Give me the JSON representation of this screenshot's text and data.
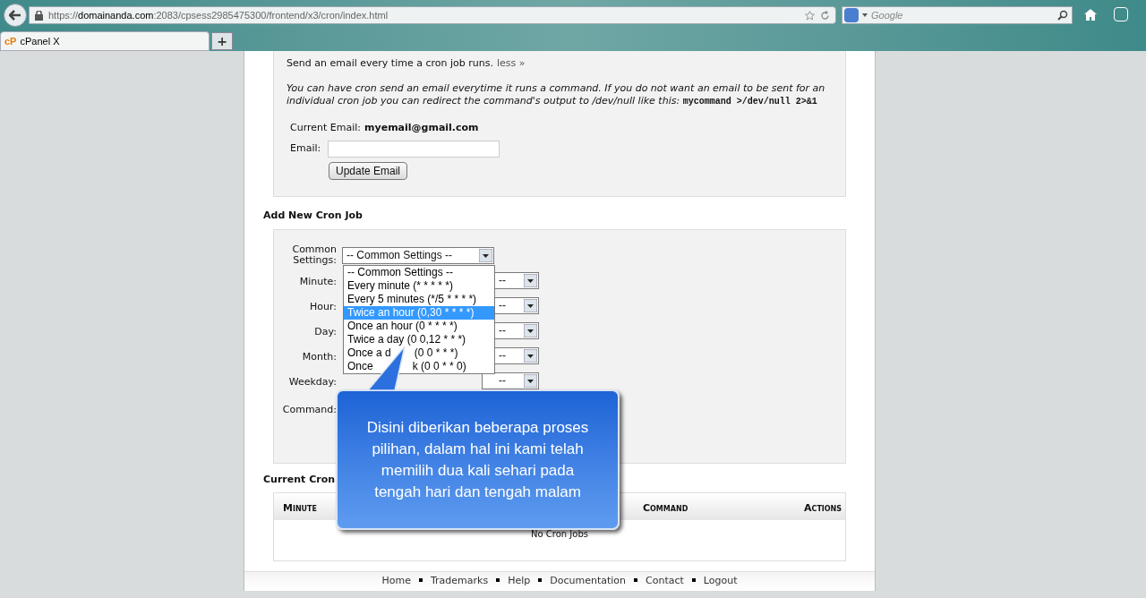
{
  "browser": {
    "url_prefix": "https://",
    "url_domain": "domainanda.com",
    "url_rest": ":2083/cpsess2985475300/frontend/x3/cron/index.html",
    "search_placeholder": "Google",
    "tab_title": "cPanel X",
    "tab_logo": "cP",
    "new_tab": "+"
  },
  "email_section": {
    "intro": "Send an email every time a cron job runs.",
    "less_link": "less »",
    "note": "You can have cron send an email everytime it runs a command. If you do not want an email to be sent for an individual cron job you can redirect the command's output to /dev/null like this:",
    "note_code": "mycommand >/dev/null 2>&1",
    "current_label": "Current Email:",
    "current_value": "myemail@gmail.com",
    "email_label": "Email:",
    "update_button": "Update Email"
  },
  "add_section": {
    "title": "Add New Cron Job",
    "common_label": "Common Settings:",
    "common_value": "-- Common Settings --",
    "options": [
      {
        "parts": [
          "-- Common Settings --"
        ],
        "selected": false
      },
      {
        "parts": [
          "Every minute (* * * * *)"
        ],
        "selected": false
      },
      {
        "parts": [
          "Every 5 minutes (*/5 * * * *)"
        ],
        "selected": false
      },
      {
        "parts": [
          "Twice an hour (0,30 * * * *)"
        ],
        "selected": true
      },
      {
        "parts": [
          "Once an hour (0 * * * *)"
        ],
        "selected": false
      },
      {
        "parts": [
          "Twice a day (0 0,12 * * *)"
        ],
        "selected": false
      },
      {
        "parts": [
          "Once a d",
          "(0 0 * * *)"
        ],
        "selected": false
      },
      {
        "parts": [
          "Once",
          "k (0 0 * * 0)"
        ],
        "selected": false
      }
    ],
    "fields": [
      {
        "label": "Minute:",
        "value": "--"
      },
      {
        "label": "Hour:",
        "value": "--"
      },
      {
        "label": "Day:",
        "value": "--"
      },
      {
        "label": "Month:",
        "value": "--"
      },
      {
        "label": "Weekday:",
        "value": "--"
      }
    ],
    "command_label": "Command:"
  },
  "current_section": {
    "title": "Current Cron",
    "columns": [
      "Minute",
      "Command",
      "Actions"
    ],
    "empty": "No Cron Jobs"
  },
  "callout": {
    "text": "Disini diberikan beberapa proses pilihan, dalam hal ini kami telah memilih dua kali sehari pada tengah hari dan tengah malam"
  },
  "footer": [
    "Home",
    "Trademarks",
    "Help",
    "Documentation",
    "Contact",
    "Logout"
  ]
}
